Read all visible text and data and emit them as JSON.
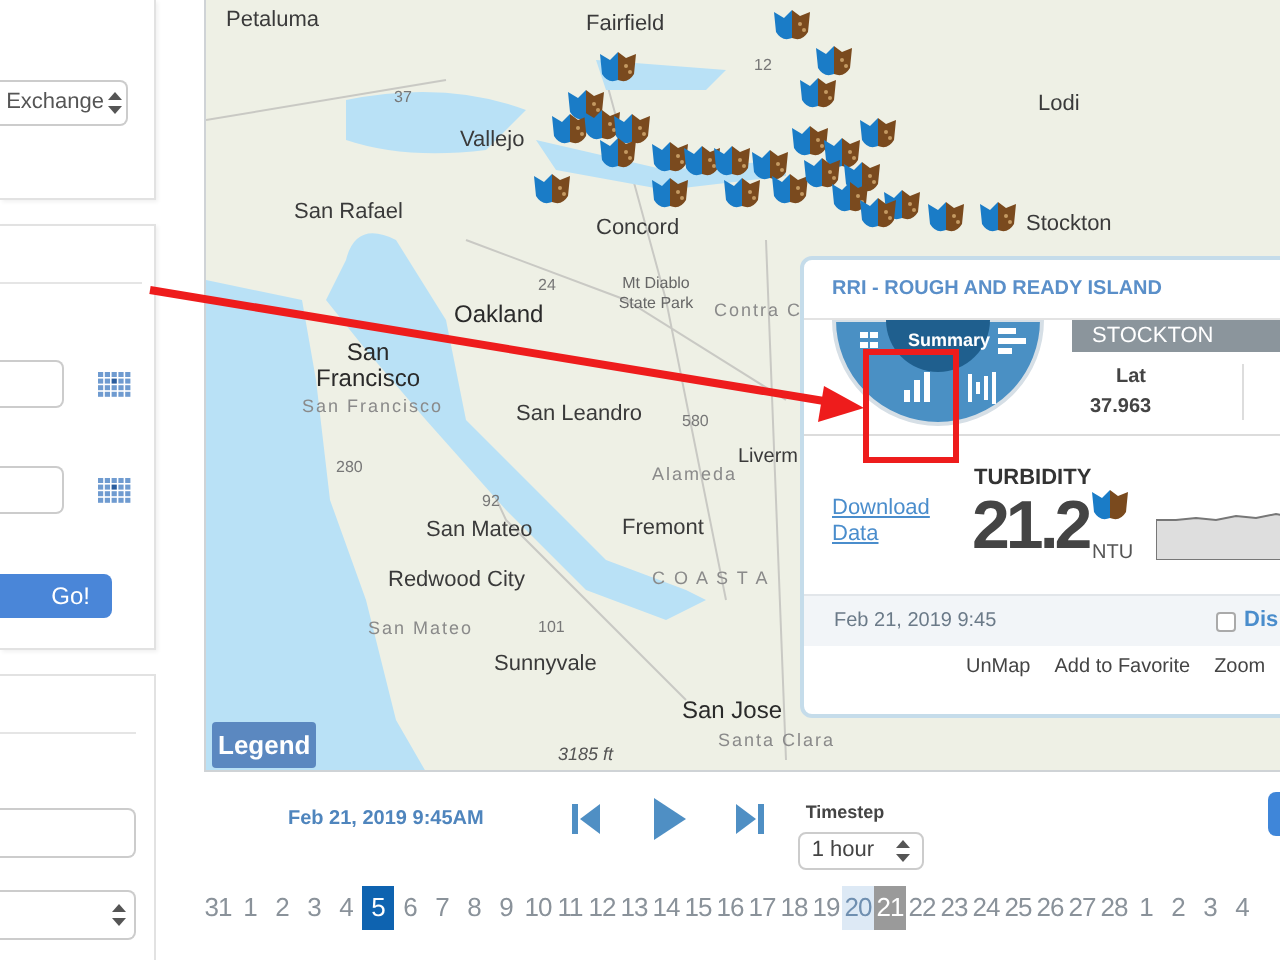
{
  "sidebar": {
    "source_select": {
      "value": "Exchange"
    },
    "go_button": {
      "label": "Go!"
    }
  },
  "map": {
    "labels": [
      {
        "text": "Petaluma",
        "kind": "city"
      },
      {
        "text": "Fairfield",
        "kind": "city"
      },
      {
        "text": "Lodi",
        "kind": "city"
      },
      {
        "text": "Vallejo",
        "kind": "city"
      },
      {
        "text": "San Rafael",
        "kind": "city"
      },
      {
        "text": "Concord",
        "kind": "city"
      },
      {
        "text": "Stockton",
        "kind": "city"
      },
      {
        "text": "Mt Diablo State Park",
        "kind": "park"
      },
      {
        "text": "Contra C",
        "kind": "area"
      },
      {
        "text": "San Francisco",
        "kind": "major"
      },
      {
        "text": "Oakland",
        "kind": "big"
      },
      {
        "text": "San Francisco",
        "kind": "area"
      },
      {
        "text": "San Leandro",
        "kind": "city"
      },
      {
        "text": "Liverm",
        "kind": "town"
      },
      {
        "text": "Alameda",
        "kind": "area"
      },
      {
        "text": "San Mateo",
        "kind": "city"
      },
      {
        "text": "Fremont",
        "kind": "city"
      },
      {
        "text": "C O A S T A",
        "kind": "area"
      },
      {
        "text": "Redwood City",
        "kind": "city"
      },
      {
        "text": "San Mateo",
        "kind": "area"
      },
      {
        "text": "Sunnyvale",
        "kind": "city"
      },
      {
        "text": "San Jose",
        "kind": "big"
      },
      {
        "text": "Santa Clara",
        "kind": "area"
      },
      {
        "text": "3185 ft",
        "kind": "elevation"
      },
      {
        "text": "12",
        "kind": "road"
      },
      {
        "text": "37",
        "kind": "road"
      },
      {
        "text": "24",
        "kind": "road"
      },
      {
        "text": "580",
        "kind": "road"
      },
      {
        "text": "92",
        "kind": "road"
      },
      {
        "text": "280",
        "kind": "road"
      },
      {
        "text": "101",
        "kind": "road"
      }
    ],
    "legend_button": {
      "label": "Legend"
    }
  },
  "popup": {
    "title": "RRI - ROUGH AND READY ISLAND",
    "wheel_center": "Summary",
    "station_tab": "STOCKTON",
    "lat_label": "Lat",
    "lat_value": "37.963",
    "parameter": "TURBIDITY",
    "download_link": "Download Data",
    "reading": "21.2",
    "unit": "NTU",
    "timestamp": "Feb 21, 2019 9:45",
    "display_checkbox": {
      "label": "Dis",
      "checked": false
    },
    "actions": [
      "UnMap",
      "Add to Favorite",
      "Zoom"
    ]
  },
  "playback": {
    "timestamp": "Feb 21, 2019 9:45AM",
    "timestep_label": "Timestep",
    "timestep_select": {
      "value": "1 hour"
    }
  },
  "days": [
    {
      "label": "31",
      "selected": false
    },
    {
      "label": "1",
      "selected": false
    },
    {
      "label": "2",
      "selected": false
    },
    {
      "label": "3",
      "selected": false
    },
    {
      "label": "4",
      "selected": false
    },
    {
      "label": "5",
      "selected": true
    },
    {
      "label": "6",
      "selected": false
    },
    {
      "label": "7",
      "selected": false
    },
    {
      "label": "8",
      "selected": false
    },
    {
      "label": "9",
      "selected": false
    },
    {
      "label": "10",
      "selected": false
    },
    {
      "label": "11",
      "selected": false
    },
    {
      "label": "12",
      "selected": false
    },
    {
      "label": "13",
      "selected": false
    },
    {
      "label": "14",
      "selected": false
    },
    {
      "label": "15",
      "selected": false
    },
    {
      "label": "16",
      "selected": false
    },
    {
      "label": "17",
      "selected": false
    },
    {
      "label": "18",
      "selected": false
    },
    {
      "label": "19",
      "selected": false
    },
    {
      "label": "20",
      "selected": false,
      "preview": true
    },
    {
      "label": "21",
      "selected": false,
      "current": true
    },
    {
      "label": "22",
      "selected": false
    },
    {
      "label": "23",
      "selected": false
    },
    {
      "label": "24",
      "selected": false
    },
    {
      "label": "25",
      "selected": false
    },
    {
      "label": "26",
      "selected": false
    },
    {
      "label": "27",
      "selected": false
    },
    {
      "label": "28",
      "selected": false
    },
    {
      "label": "1",
      "selected": false
    },
    {
      "label": "2",
      "selected": false
    },
    {
      "label": "3",
      "selected": false
    },
    {
      "label": "4",
      "selected": false
    }
  ]
}
